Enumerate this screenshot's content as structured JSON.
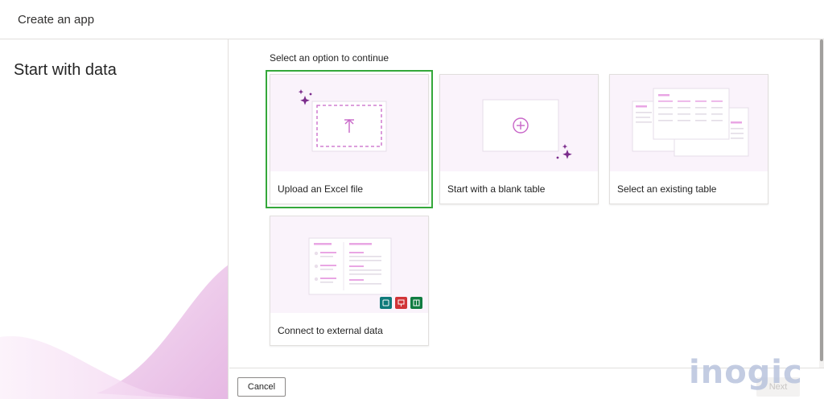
{
  "header": {
    "title": "Create an app"
  },
  "sidebar": {
    "heading": "Start with data"
  },
  "main": {
    "prompt": "Select an option to continue",
    "cards": [
      {
        "label": "Upload an Excel file",
        "selected": true
      },
      {
        "label": "Start with a blank table",
        "selected": false
      },
      {
        "label": "Select an existing table",
        "selected": false
      },
      {
        "label": "Connect to external data",
        "selected": false
      }
    ]
  },
  "footer": {
    "cancel_label": "Cancel",
    "next_label": "Next"
  },
  "watermark": {
    "text": "inogic"
  },
  "colors": {
    "accent": "#c866c8",
    "selection": "#34a83a",
    "sparkle": "#7b2c8c",
    "art_bg": "#faf3fb"
  }
}
